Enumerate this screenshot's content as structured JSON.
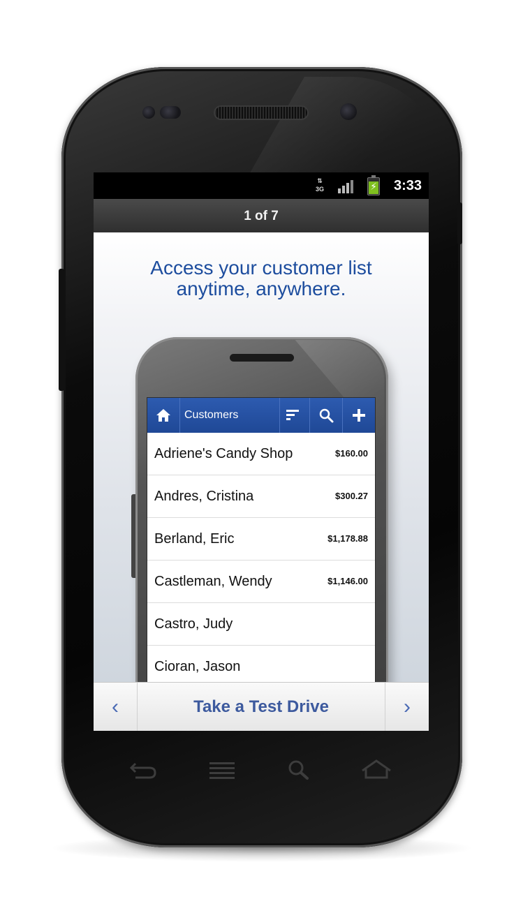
{
  "status_bar": {
    "network": "3G",
    "time": "3:33"
  },
  "pager": {
    "label": "1 of 7"
  },
  "headline": {
    "line1": "Access your customer list",
    "line2": "anytime, anywhere."
  },
  "app": {
    "title": "Customers",
    "icons": [
      "home-icon",
      "sort-icon",
      "search-icon",
      "add-icon"
    ],
    "customers": [
      {
        "name": "Adriene's Candy Shop",
        "amount": "$160.00"
      },
      {
        "name": "Andres, Cristina",
        "amount": "$300.27"
      },
      {
        "name": "Berland, Eric",
        "amount": "$1,178.88"
      },
      {
        "name": "Castleman, Wendy",
        "amount": "$1,146.00"
      },
      {
        "name": "Castro, Judy",
        "amount": ""
      },
      {
        "name": "Cioran, Jason",
        "amount": ""
      }
    ]
  },
  "bottom_bar": {
    "prev_icon": "‹",
    "cta_label": "Take a Test Drive",
    "next_icon": "›"
  },
  "colors": {
    "accent": "#1d4d9e",
    "app_bar": "#2552a6",
    "battery": "#7fbf1f"
  }
}
